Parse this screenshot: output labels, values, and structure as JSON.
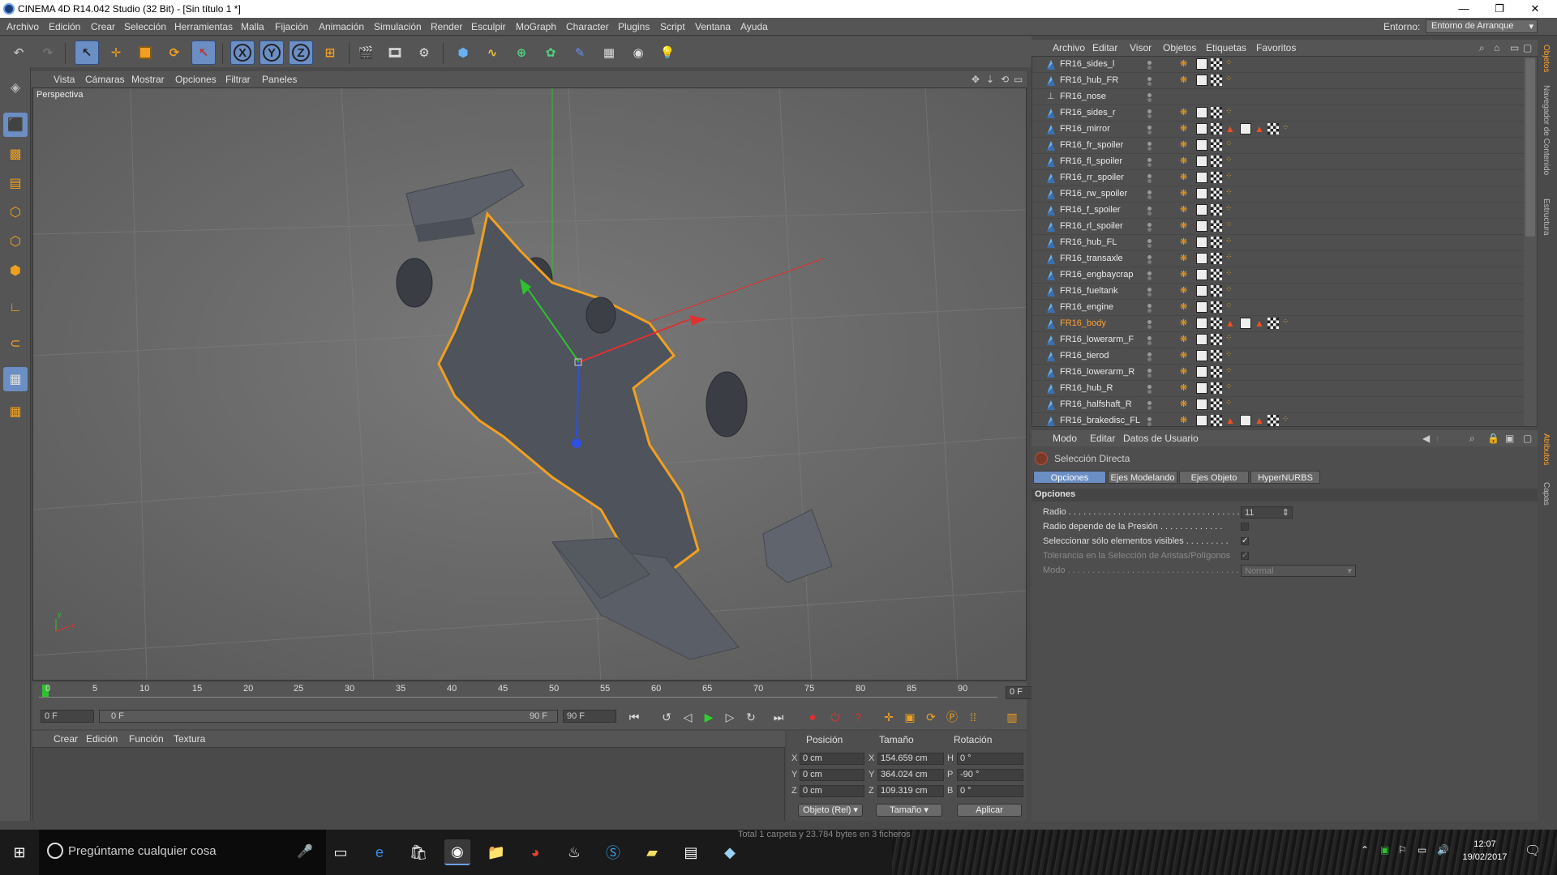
{
  "window": {
    "title": "CINEMA 4D R14.042 Studio (32 Bit) - [Sin título 1 *]",
    "minimize": "—",
    "maximize": "❐",
    "close": "✕"
  },
  "menubar": {
    "items": [
      "Archivo",
      "Edición",
      "Crear",
      "Selección",
      "Herramientas",
      "Malla",
      "Fijación",
      "Animación",
      "Simulación",
      "Render",
      "Esculpir",
      "MoGraph",
      "Character",
      "Plugins",
      "Script",
      "Ventana",
      "Ayuda"
    ],
    "env_label": "Entorno:",
    "env_value": "Entorno de Arranque"
  },
  "toolbar": {
    "x_label": "X",
    "y_label": "Y",
    "z_label": "Z"
  },
  "viewport": {
    "menu": [
      "Vista",
      "Cámaras",
      "Mostrar",
      "Opciones",
      "Filtrar",
      "Paneles"
    ],
    "label": "Perspectiva"
  },
  "timeline": {
    "ticks": [
      "0",
      "5",
      "10",
      "15",
      "20",
      "25",
      "30",
      "35",
      "40",
      "45",
      "50",
      "55",
      "60",
      "65",
      "70",
      "75",
      "80",
      "85",
      "90"
    ],
    "current_frame": "0 F",
    "start_field": "0 F",
    "range_start": "0 F",
    "range_end": "90 F",
    "end_field": "90 F"
  },
  "material_manager": {
    "menu": [
      "Crear",
      "Edición",
      "Función",
      "Textura"
    ]
  },
  "coordinates": {
    "headers": {
      "position": "Posición",
      "size": "Tamaño",
      "rotation": "Rotación"
    },
    "rows": [
      {
        "axis": "X",
        "pos": "0 cm",
        "size_axis": "X",
        "size": "154.659 cm",
        "rot_axis": "H",
        "rot": "0 °"
      },
      {
        "axis": "Y",
        "pos": "0 cm",
        "size_axis": "Y",
        "size": "364.024 cm",
        "rot_axis": "P",
        "rot": "-90 °"
      },
      {
        "axis": "Z",
        "pos": "0 cm",
        "size_axis": "Z",
        "size": "109.319 cm",
        "rot_axis": "B",
        "rot": "0 °"
      }
    ],
    "mode_select": "Objeto (Rel)",
    "size_select": "Tamaño",
    "apply_button": "Aplicar"
  },
  "objects": {
    "menu": [
      "Archivo",
      "Editar",
      "Visor",
      "Objetos",
      "Etiquetas",
      "Favoritos"
    ],
    "items": [
      {
        "name": "FR16_sides_l",
        "kind": "poly",
        "active": false,
        "extra": false
      },
      {
        "name": "FR16_hub_FR",
        "kind": "poly",
        "active": false,
        "extra": false
      },
      {
        "name": "FR16_nose",
        "kind": "null",
        "active": false,
        "extra": false
      },
      {
        "name": "FR16_sides_r",
        "kind": "poly",
        "active": false,
        "extra": false
      },
      {
        "name": "FR16_mirror",
        "kind": "poly",
        "active": false,
        "extra": true
      },
      {
        "name": "FR16_fr_spoiler",
        "kind": "poly",
        "active": false,
        "extra": false
      },
      {
        "name": "FR16_fl_spoiler",
        "kind": "poly",
        "active": false,
        "extra": false
      },
      {
        "name": "FR16_rr_spoiler",
        "kind": "poly",
        "active": false,
        "extra": false
      },
      {
        "name": "FR16_rw_spoiler",
        "kind": "poly",
        "active": false,
        "extra": false
      },
      {
        "name": "FR16_f_spoiler",
        "kind": "poly",
        "active": false,
        "extra": false
      },
      {
        "name": "FR16_rl_spoiler",
        "kind": "poly",
        "active": false,
        "extra": false
      },
      {
        "name": "FR16_hub_FL",
        "kind": "poly",
        "active": false,
        "extra": false
      },
      {
        "name": "FR16_transaxle",
        "kind": "poly",
        "active": false,
        "extra": false
      },
      {
        "name": "FR16_engbaycrap",
        "kind": "poly",
        "active": false,
        "extra": false
      },
      {
        "name": "FR16_fueltank",
        "kind": "poly",
        "active": false,
        "extra": false
      },
      {
        "name": "FR16_engine",
        "kind": "poly",
        "active": false,
        "extra": false
      },
      {
        "name": "FR16_body",
        "kind": "poly",
        "active": true,
        "extra": true
      },
      {
        "name": "FR16_lowerarm_F",
        "kind": "poly",
        "active": false,
        "extra": false
      },
      {
        "name": "FR16_tierod",
        "kind": "poly",
        "active": false,
        "extra": false
      },
      {
        "name": "FR16_lowerarm_R",
        "kind": "poly",
        "active": false,
        "extra": false
      },
      {
        "name": "FR16_hub_R",
        "kind": "poly",
        "active": false,
        "extra": false
      },
      {
        "name": "FR16_halfshaft_R",
        "kind": "poly",
        "active": false,
        "extra": false
      },
      {
        "name": "FR16_brakedisc_FL",
        "kind": "poly",
        "active": false,
        "extra": true
      }
    ]
  },
  "attributes": {
    "menu": [
      "Modo",
      "Editar",
      "Datos de Usuario"
    ],
    "tool_name": "Selección Directa",
    "tabs": [
      "Opciones",
      "Ejes Modelando",
      "Ejes Objeto",
      "HyperNURBS"
    ],
    "section": "Opciones",
    "fields": [
      {
        "label": "Radio . . . . . . . . . . . . . . . . . . . . . . . . . . . . . . . . . . . . . . . . .",
        "value": "11",
        "type": "number"
      },
      {
        "label": "Radio depende de la Presión . . . . . . . . . . . . .",
        "value": "",
        "type": "check"
      },
      {
        "label": "Seleccionar sólo elementos visibles . . . . . . . . .",
        "value": "✓",
        "type": "check"
      },
      {
        "label": "Tolerancia en la Selección de Aristas/Polígonos",
        "value": "✓",
        "type": "check_dim"
      },
      {
        "label": "Modo . . . . . . . . . . . . . . . . . . . . . . . . . . . . . . . . . . . . . . . . .",
        "value": "Normal",
        "type": "select_dim"
      }
    ]
  },
  "sidetabs": {
    "top": [
      "Objetos",
      "Navegador de Contenido",
      "Estructura"
    ],
    "bottom": [
      "Atributos",
      "Capas"
    ]
  },
  "status_bar": {
    "text": "Total 1 carpeta y 23.784 bytes en 3 ficheros"
  },
  "taskbar": {
    "search_placeholder": "Pregúntame cualquier cosa",
    "time": "12:07",
    "date": "19/02/2017"
  },
  "colors": {
    "accent_selected": "#6b8ec4",
    "active_object": "#ffa030",
    "axis_x": "#e03030",
    "axis_y": "#30c030",
    "axis_z": "#3050e0"
  }
}
